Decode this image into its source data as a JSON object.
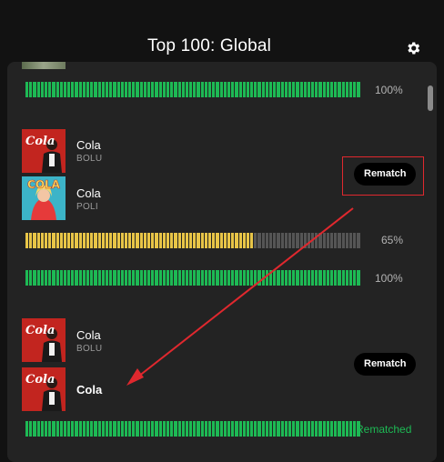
{
  "header": {
    "title": "Top 100: Global",
    "settings_icon": "gear-icon"
  },
  "colors": {
    "accent_green": "#1db954",
    "match_yellow": "#e8c547",
    "unfilled_bar": "#555555",
    "annotation_red": "#e0282e"
  },
  "rows": [
    {
      "match_percent_label": "100%",
      "match_fill": 1.0
    },
    {
      "source_track": {
        "title": "Cola",
        "artist": "BOLU",
        "cover_text": "Cola"
      },
      "matched_track": {
        "title": "Cola",
        "artist": "POLI",
        "cover_text": "COLA"
      },
      "action_label": "Rematch",
      "match_percent_label": "65%",
      "match_fill": 0.68,
      "confirm_percent_label": "100%",
      "confirm_fill": 1.0
    },
    {
      "source_track": {
        "title": "Cola",
        "artist": "BOLU",
        "cover_text": "Cola"
      },
      "matched_track": {
        "title": "Cola",
        "cover_text": "Cola"
      },
      "action_label": "Rematch",
      "status_label": "Rematched",
      "match_fill": 1.0
    }
  ]
}
